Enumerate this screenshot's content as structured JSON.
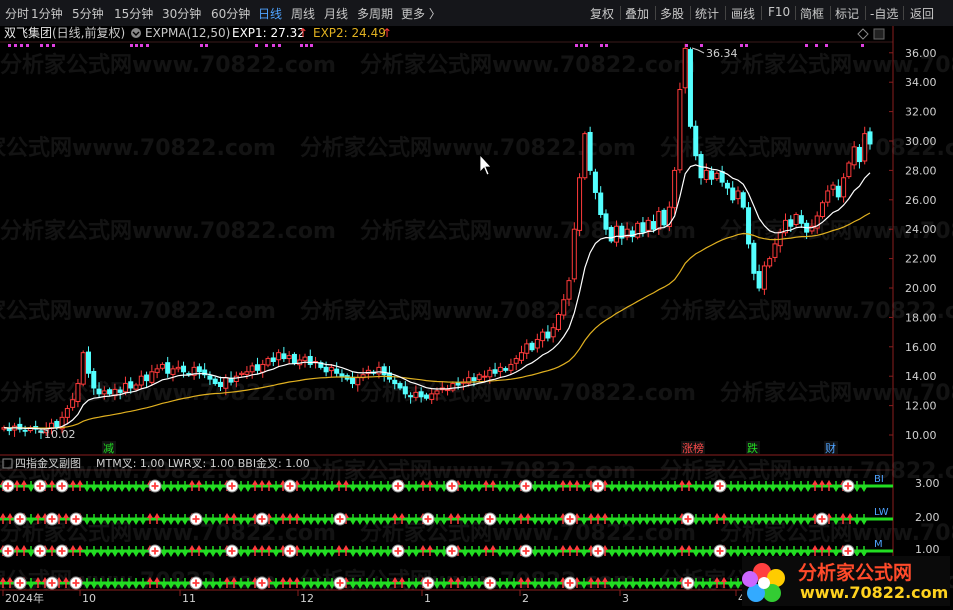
{
  "toolbar": {
    "periods": [
      "分时",
      "1分钟",
      "5分钟",
      "15分钟",
      "30分钟",
      "60分钟",
      "日线",
      "周线",
      "月线",
      "多周期",
      "更多 〉"
    ],
    "active_period": "日线",
    "tools": [
      "复权",
      "叠加",
      "多股",
      "统计",
      "画线",
      "F10",
      "简框",
      "标记",
      "-自选",
      "返回"
    ]
  },
  "main_panel": {
    "stock_name": "双飞集团",
    "mode": "(日线,前复权)",
    "indicator": "EXPMA(12,50)",
    "exp1_label": "EXP1: 27.32",
    "exp2_label": "EXP2: 24.49",
    "up_arrow": "↑",
    "high_label": "36.34",
    "low_label": "10.02",
    "y_ticks": [
      "36.00",
      "34.00",
      "32.00",
      "30.00",
      "28.00",
      "26.00",
      "24.00",
      "22.00",
      "20.00",
      "18.00",
      "16.00",
      "14.00",
      "12.00",
      "10.00"
    ],
    "event_tags": [
      "减",
      "涨榜",
      "跌",
      "财"
    ]
  },
  "sub_panel": {
    "name": "四指金叉副图",
    "legend": "MTM叉: 1.00  LWR叉: 1.00  BBI金叉: 1.00",
    "y_ticks": [
      "3.00",
      "2.00",
      "1.00"
    ],
    "row_labels": [
      "BI",
      "LW",
      "M"
    ]
  },
  "x_axis": {
    "labels": [
      "2024年",
      "10",
      "11",
      "12",
      "1",
      "2",
      "3",
      "4"
    ]
  },
  "watermark": {
    "text": "分析家公式网www.70822.com",
    "short": "分析家公式网"
  },
  "logo": {
    "title": "分析家公式网",
    "url": "www.70822.com"
  },
  "colors": {
    "up": "#ff3b3b",
    "down": "#54ffff",
    "exp1": "#ffffff",
    "exp2": "#e0b020",
    "signal": "#22dd22",
    "accent": "#4fa3ff"
  },
  "chart_data": {
    "type": "candlestick",
    "title": "双飞集团",
    "x_labels": [
      "2024年",
      "10",
      "11",
      "12",
      "1",
      "2",
      "3",
      "4"
    ],
    "ylim": [
      10,
      37
    ],
    "y_ticks": [
      36,
      34,
      32,
      30,
      28,
      26,
      24,
      22,
      20,
      18,
      16,
      14,
      12,
      10
    ],
    "close_path": [
      10.5,
      10.3,
      10.6,
      10.4,
      10.3,
      10.5,
      10.4,
      10.2,
      10.4,
      10.8,
      10.5,
      11.2,
      11.8,
      12.4,
      13.5,
      15.6,
      14.2,
      13.2,
      12.8,
      13.0,
      12.8,
      13.1,
      12.9,
      13.5,
      13.2,
      13.4,
      14.0,
      13.7,
      14.3,
      14.5,
      14.8,
      14.2,
      14.5,
      14.6,
      14.3,
      14.1,
      14.6,
      14.3,
      14.1,
      13.8,
      13.5,
      13.3,
      13.9,
      13.6,
      14.0,
      14.2,
      14.3,
      14.7,
      14.4,
      14.8,
      15.2,
      15.0,
      15.6,
      15.2,
      15.4,
      14.9,
      15.1,
      15.3,
      14.8,
      15.0,
      14.6,
      14.3,
      14.6,
      14.2,
      14.0,
      13.8,
      13.5,
      13.9,
      14.1,
      14.4,
      14.2,
      14.6,
      14.1,
      13.8,
      13.5,
      13.2,
      12.8,
      12.6,
      12.9,
      12.6,
      12.5,
      12.8,
      13.0,
      13.2,
      13.1,
      13.5,
      13.4,
      13.6,
      13.9,
      13.7,
      14.1,
      14.0,
      14.4,
      14.2,
      14.6,
      14.4,
      14.8,
      15.2,
      15.6,
      16.2,
      15.8,
      16.5,
      17.0,
      16.6,
      17.3,
      18.2,
      19.2,
      20.5,
      24.0,
      27.5,
      30.5,
      28.0,
      26.5,
      25.0,
      24.0,
      23.2,
      24.2,
      23.4,
      24.0,
      23.5,
      24.4,
      23.8,
      24.6,
      24.0,
      25.2,
      24.3,
      25.5,
      28.0,
      33.5,
      36.3,
      31.0,
      29.0,
      27.5,
      28.0,
      27.4,
      27.8,
      27.2,
      26.8,
      26.0,
      26.6,
      25.5,
      23.0,
      21.0,
      20.0,
      21.5,
      22.0,
      23.0,
      23.8,
      24.6,
      24.2,
      25.0,
      24.4,
      23.8,
      24.2,
      24.9,
      25.8,
      26.6,
      27.0,
      26.2,
      27.5,
      28.5,
      29.6,
      28.6,
      30.5,
      29.8
    ]
  }
}
